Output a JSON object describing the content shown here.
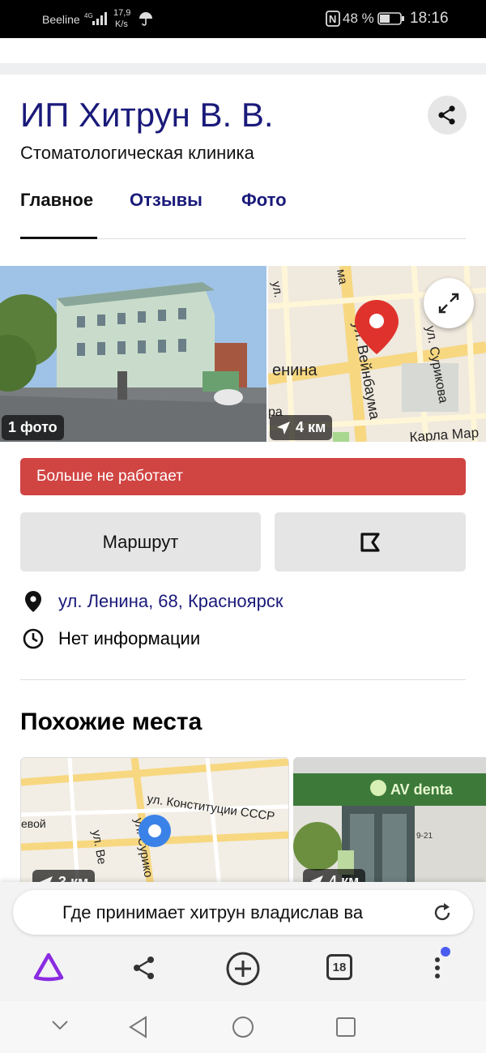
{
  "status": {
    "carrier": "Beeline",
    "net_speed": "17,9",
    "net_unit": "K/s",
    "battery": "48 %",
    "time": "18:16"
  },
  "place": {
    "name": "ИП Хитрун В. В.",
    "category": "Стоматологическая клиника"
  },
  "tabs": [
    {
      "label": "Главное"
    },
    {
      "label": "Отзывы"
    },
    {
      "label": "Фото"
    }
  ],
  "media": {
    "photo_count": "1 фото",
    "map_distance": "4 км",
    "map_streets": {
      "lenina": "енина",
      "veinbauma": "ул. Вейнбаума",
      "surikova": "ул. Сурикова",
      "karla_marksa": "Карла Мар",
      "ul_top": "ул.",
      "ma": "ма",
      "ra": "ра"
    }
  },
  "status_banner": "Больше не работает",
  "actions": {
    "route_label": "Маршрут"
  },
  "info": {
    "address": "ул. Ленина, 68, Красноярск",
    "hours": "Нет информации"
  },
  "similar": {
    "title": "Похожие места",
    "card1": {
      "distance": "3 км",
      "street1": "ул. Конституции СССР",
      "street2": "евой",
      "street3": "ул. Ве",
      "street4": "ул. Сурико"
    },
    "card2": {
      "distance": "4 км",
      "sign": "AV denta",
      "sign_num": "9-21"
    }
  },
  "search": {
    "query": "Где принимает хитрун владислав ва"
  },
  "toolbar": {
    "tabs_count": "18"
  },
  "colors": {
    "title": "#1a1a7a",
    "banner": "#d04442",
    "accent": "#8a2be2",
    "pin": "#e0322d",
    "notify": "#4a5cf0"
  }
}
